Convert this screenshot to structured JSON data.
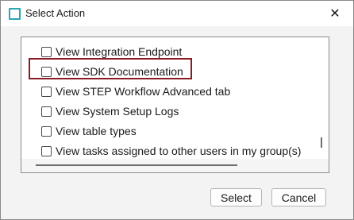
{
  "window": {
    "title": "Select Action",
    "close_symbol": "✕"
  },
  "list": {
    "items": [
      {
        "label": "View Integration Endpoint",
        "checked": false
      },
      {
        "label": "View SDK Documentation",
        "checked": false,
        "highlighted": true
      },
      {
        "label": "View STEP Workflow Advanced tab",
        "checked": false
      },
      {
        "label": "View System Setup Logs",
        "checked": false
      },
      {
        "label": "View table types",
        "checked": false
      },
      {
        "label": "View tasks assigned to other users in my group(s)",
        "checked": false
      }
    ]
  },
  "buttons": {
    "select_label": "Select",
    "cancel_label": "Cancel"
  },
  "colors": {
    "highlight_border": "#8b1a24",
    "app_icon": "#2aa6b4"
  }
}
